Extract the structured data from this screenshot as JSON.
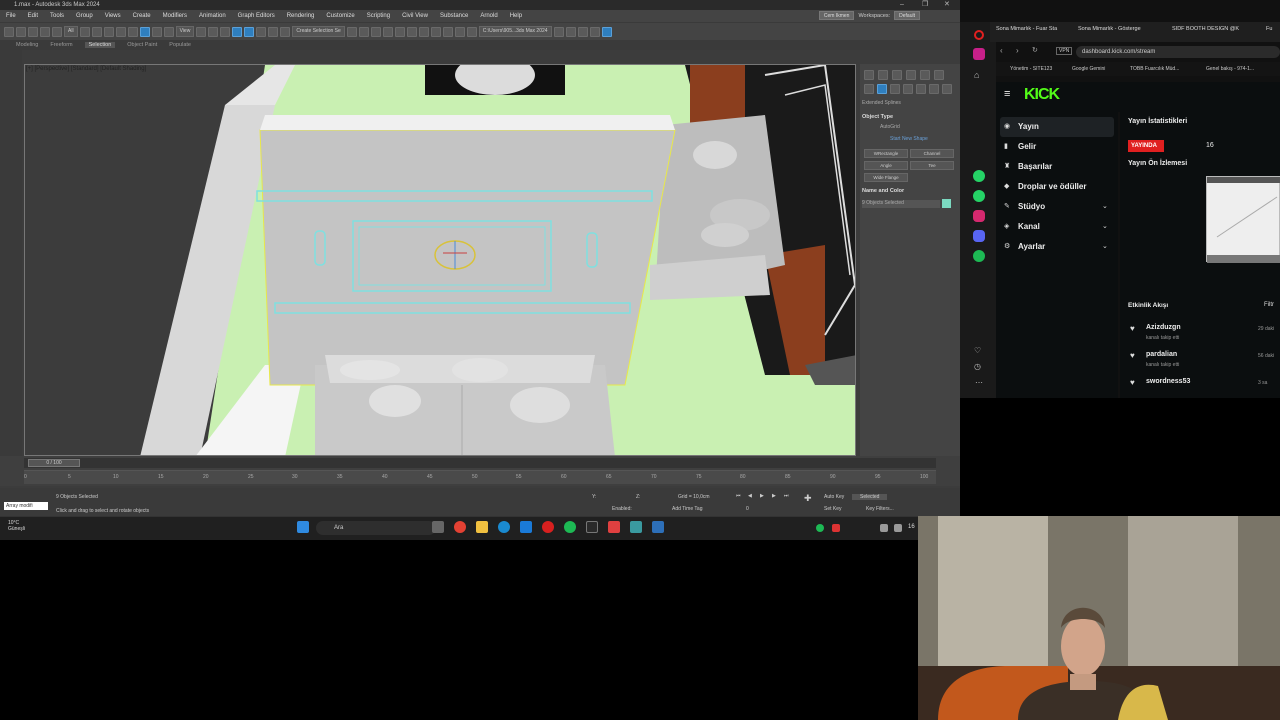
{
  "max": {
    "title": "1.max - Autodesk 3ds Max 2024",
    "menu": [
      "File",
      "Edit",
      "Tools",
      "Group",
      "Views",
      "Create",
      "Modifiers",
      "Animation",
      "Graph Editors",
      "Rendering",
      "Customize",
      "Scripting",
      "Civil View",
      "Substance",
      "Arnold",
      "Help"
    ],
    "user": "Cem Ikmen",
    "workspaces_label": "Workspaces:",
    "workspace": "Default",
    "selection_filter": "All",
    "create_selection_set": "Create Selection Se",
    "path": "C:\\Users\\905...3ds Max 2024",
    "ribbon": [
      "Modeling",
      "Freeform",
      "Selection",
      "Object Paint",
      "Populate"
    ],
    "ribbon_active": "Selection",
    "viewport_label": "[+] [Perspective] [Standard] [Default Shading]",
    "command_panel": {
      "spline_category": "Extended Splines",
      "object_type": "Object Type",
      "autogrid": "AutoGrid",
      "start_new_shape": "Start New Shape",
      "buttons": [
        "WRectangle",
        "Channel",
        "Angle",
        "Tee",
        "Wide Flange"
      ],
      "name_and_color": "Name and Color",
      "objects_selected": "9 Objects Selected",
      "color": "#7bd9c0"
    },
    "timeline": {
      "frame": "0 / 100",
      "ticks": [
        "0",
        "5",
        "10",
        "15",
        "20",
        "25",
        "30",
        "35",
        "40",
        "45",
        "50",
        "55",
        "60",
        "65",
        "70",
        "75",
        "80",
        "85",
        "90",
        "95",
        "100"
      ]
    },
    "status": {
      "objects_selected": "9 Objects Selected",
      "prompt": "Click and drag to select and rotate objects",
      "maxscript": "Array modifi",
      "x_label": "X:",
      "y_label": "Y:",
      "z_label": "Z:",
      "grid": "Grid = 10,0cm",
      "enabled": "Enabled:",
      "add_time_tag": "Add Time Tag",
      "auto_key": "Auto Key",
      "selected": "Selected",
      "set_key": "Set Key",
      "key_filters": "Key Filters...",
      "frame_value": "0"
    }
  },
  "taskbar": {
    "weather_temp": "10°C",
    "weather_desc": "Güneşli",
    "search": "Ara",
    "time": "16"
  },
  "browser": {
    "tabs": [
      "Sona Mimarlık - Fuar Sta",
      "Sona Mimarlık - Gösterge",
      "SIDF BOOTH DESIGN @K",
      "Fu"
    ],
    "url": "dashboard.kick.com/stream",
    "vpn": "VPN",
    "bookmarks": [
      "Yönetim - SITE123",
      "Google Gemini",
      "TOBB Fuarcılık Müd...",
      "Genel bakış - 974-1..."
    ],
    "kick": {
      "logo": "KICK",
      "nav": [
        {
          "label": "Yayın",
          "icon": "broadcast-icon",
          "chevron": false
        },
        {
          "label": "Gelir",
          "icon": "money-icon",
          "chevron": false
        },
        {
          "label": "Başarılar",
          "icon": "trophy-icon",
          "chevron": false
        },
        {
          "label": "Droplar ve ödüller",
          "icon": "gift-icon",
          "chevron": false
        },
        {
          "label": "Stüdyo",
          "icon": "studio-icon",
          "chevron": true
        },
        {
          "label": "Kanal",
          "icon": "channel-icon",
          "chevron": true
        },
        {
          "label": "Ayarlar",
          "icon": "settings-icon",
          "chevron": true
        }
      ],
      "stats_title": "Yayın İstatistikleri",
      "live_badge": "YAYINDA",
      "viewers": "16",
      "preview_title": "Yayın Ön İzlemesi",
      "activity_title": "Etkinlik Akışı",
      "filter": "Filtr",
      "events": [
        {
          "user": "Azizduzgn",
          "text": "kanalı takip etti",
          "time": "29 daki"
        },
        {
          "user": "pardalian",
          "text": "kanalı takip etti",
          "time": "56 daki"
        },
        {
          "user": "swordness53",
          "text": "",
          "time": "3 sa"
        }
      ]
    }
  }
}
